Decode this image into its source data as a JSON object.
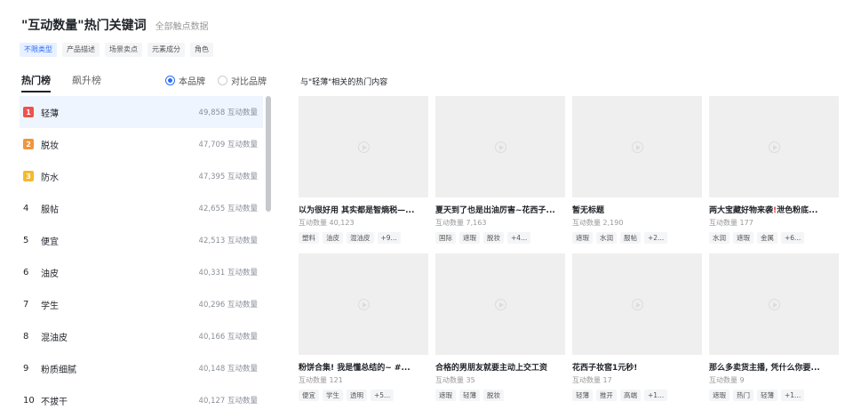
{
  "header": {
    "title": "\"互动数量\"热门关键词",
    "subtitle": "全部触点数据"
  },
  "filters": [
    "不限类型",
    "产品描述",
    "场景卖点",
    "元素成分",
    "角色"
  ],
  "tabs": [
    "热门榜",
    "飙升榜"
  ],
  "brand_toggle": [
    "本品牌",
    "对比品牌"
  ],
  "colors": {
    "rank1": "#f0514c",
    "rank2": "#f2953b",
    "rank3": "#f5b92e",
    "accent": "#2b6cf6"
  },
  "keywords": [
    {
      "rank": "1",
      "word": "轻薄",
      "count": "49,858 互动数量"
    },
    {
      "rank": "2",
      "word": "脱妆",
      "count": "47,709 互动数量"
    },
    {
      "rank": "3",
      "word": "防水",
      "count": "47,395 互动数量"
    },
    {
      "rank": "4",
      "word": "服帖",
      "count": "42,655 互动数量"
    },
    {
      "rank": "5",
      "word": "便宜",
      "count": "42,513 互动数量"
    },
    {
      "rank": "6",
      "word": "油皮",
      "count": "40,331 互动数量"
    },
    {
      "rank": "7",
      "word": "学生",
      "count": "40,296 互动数量"
    },
    {
      "rank": "8",
      "word": "混油皮",
      "count": "40,166 互动数量"
    },
    {
      "rank": "9",
      "word": "粉质细腻",
      "count": "40,148 互动数量"
    },
    {
      "rank": "10",
      "word": "不拔干",
      "count": "40,127 互动数量"
    }
  ],
  "content": {
    "title": "与\"轻薄\"相关的热门内容",
    "cards": [
      {
        "title": "以为很好用 其实都是智熵税—...",
        "count": "互动数量 40,123",
        "tags": [
          "塑料",
          "油皮",
          "混油皮",
          "+9..."
        ]
      },
      {
        "title": "夏天到了也是出油厉害~花西子...",
        "count": "互动数量 7,163",
        "tags": [
          "国际",
          "遮瑕",
          "脱妆",
          "+4..."
        ]
      },
      {
        "title": "暂无标题",
        "count": "互动数量 2,190",
        "tags": [
          "遮瑕",
          "水润",
          "服帖",
          "+2..."
        ]
      },
      {
        "title": "两大宝藏好物来袭",
        "title_mark": "!",
        "title_rest": "泄色粉底...",
        "count": "互动数量 177",
        "tags": [
          "水润",
          "遮瑕",
          "金属",
          "+6..."
        ]
      },
      {
        "title": "粉饼合集! 我是懂总结的~ #...",
        "count": "互动数量 121",
        "tags": [
          "便宜",
          "学生",
          "透明",
          "+5..."
        ]
      },
      {
        "title": "合格的男朋友就要主动上交工资",
        "count": "互动数量 35",
        "tags": [
          "遮瑕",
          "轻薄",
          "脱妆"
        ]
      },
      {
        "title": "花西子妆窖1元秒!",
        "count": "互动数量 17",
        "tags": [
          "轻薄",
          "推开",
          "高端",
          "+1..."
        ]
      },
      {
        "title": "那么多卖货主播, 凭什么你要...",
        "count": "互动数量 9",
        "tags": [
          "遮瑕",
          "热门",
          "轻薄",
          "+1..."
        ]
      }
    ]
  }
}
